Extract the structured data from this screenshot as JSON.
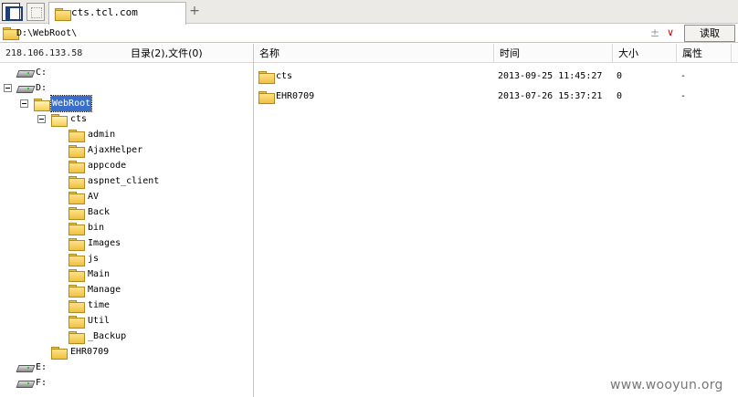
{
  "tab": {
    "title": "cts.tcl.com",
    "new_tab": "+"
  },
  "address": {
    "path": "D:\\WebRoot\\",
    "plusminus": "±",
    "dropdown": "∨",
    "read_label": "读取"
  },
  "left_header": {
    "ip": "218.106.133.58",
    "summary": "目录(2),文件(0)"
  },
  "columns": {
    "name": "名称",
    "time": "时间",
    "size": "大小",
    "attr": "属性"
  },
  "tree": {
    "drive_c": "C:",
    "drive_d": "D:",
    "webroot": "WebRoot",
    "cts": "cts",
    "children": [
      "admin",
      "AjaxHelper",
      "appcode",
      "aspnet_client",
      "AV",
      "Back",
      "bin",
      "Images",
      "js",
      "Main",
      "Manage",
      "time",
      "Util",
      "_Backup"
    ],
    "ehr": "EHR0709",
    "drive_e": "E:",
    "drive_f": "F:"
  },
  "files": [
    {
      "name": "cts",
      "time": "2013-09-25 11:45:27",
      "size": "0",
      "attr": "-"
    },
    {
      "name": "EHR0709",
      "time": "2013-07-26 15:37:21",
      "size": "0",
      "attr": "-"
    }
  ],
  "watermark": "www.wooyun.org"
}
